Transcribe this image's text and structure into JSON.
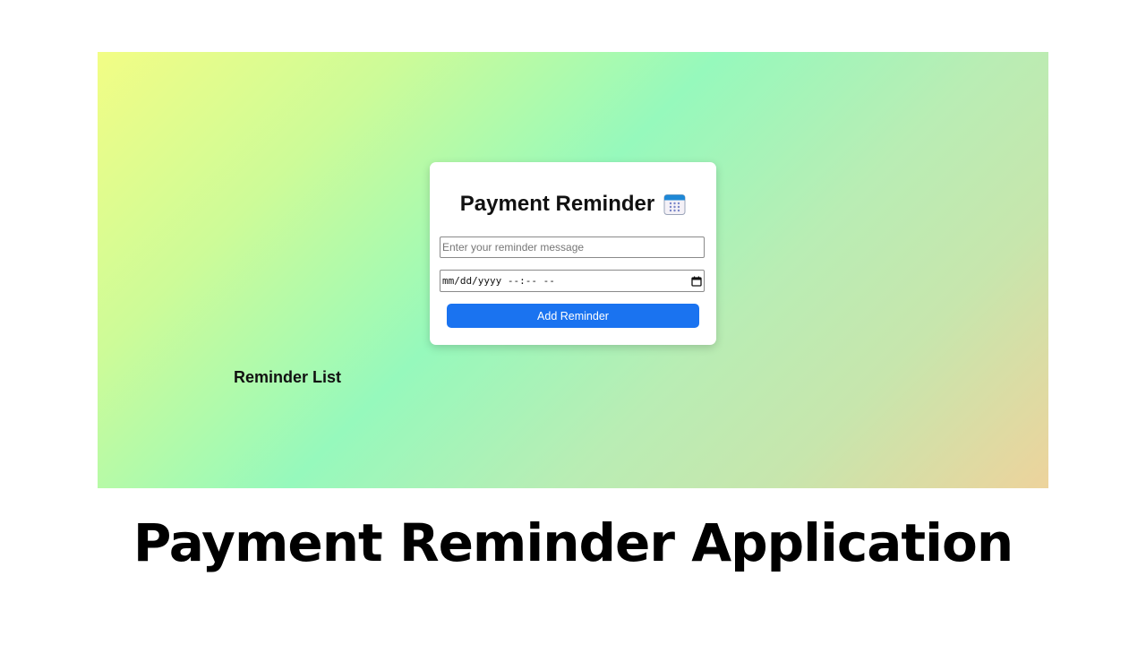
{
  "app": {
    "title": "Payment Reminder",
    "title_icon": "calendar-icon",
    "message_input": {
      "placeholder": "Enter your reminder message",
      "value": ""
    },
    "datetime_input": {
      "placeholder": "mm/dd/yyyy --:-- --",
      "value": "",
      "picker_icon": "calendar-picker-icon"
    },
    "add_button_label": "Add Reminder",
    "list_heading": "Reminder List",
    "colors": {
      "button": "#1a73f0",
      "gradient_start": "#f2fd85",
      "gradient_mid": "#96f9bc",
      "gradient_end": "#edd39c"
    }
  },
  "caption": "Payment Reminder Application"
}
